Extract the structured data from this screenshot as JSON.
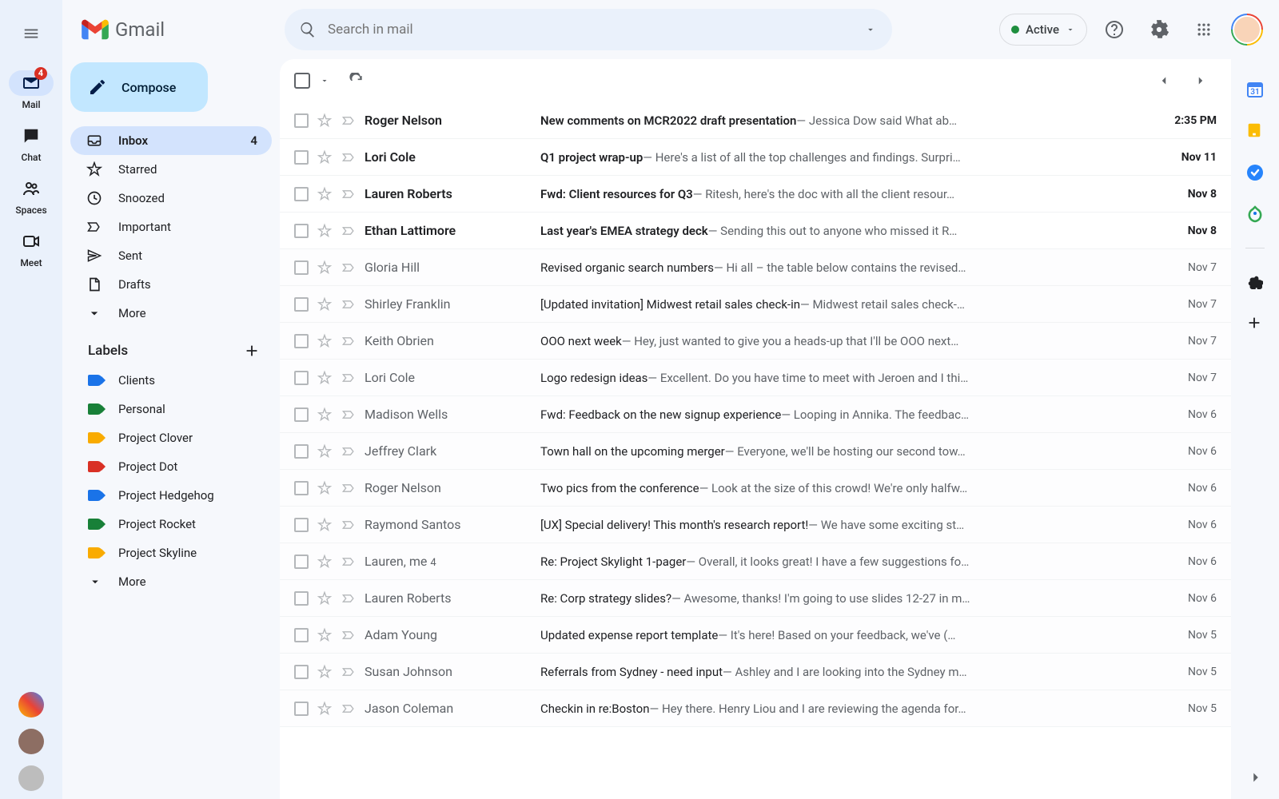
{
  "app": {
    "name": "Gmail"
  },
  "search": {
    "placeholder": "Search in mail"
  },
  "status": {
    "label": "Active"
  },
  "rail": {
    "items": [
      {
        "label": "Mail",
        "badge": "4"
      },
      {
        "label": "Chat"
      },
      {
        "label": "Spaces"
      },
      {
        "label": "Meet"
      }
    ]
  },
  "compose": {
    "label": "Compose"
  },
  "nav": {
    "items": [
      {
        "label": "Inbox",
        "count": "4",
        "icon": "inbox"
      },
      {
        "label": "Starred",
        "icon": "star"
      },
      {
        "label": "Snoozed",
        "icon": "clock"
      },
      {
        "label": "Important",
        "icon": "important"
      },
      {
        "label": "Sent",
        "icon": "send"
      },
      {
        "label": "Drafts",
        "icon": "draft"
      },
      {
        "label": "More",
        "icon": "chevron-down"
      }
    ]
  },
  "labels": {
    "header": "Labels",
    "items": [
      {
        "label": "Clients",
        "color": "#1a73e8"
      },
      {
        "label": "Personal",
        "color": "#188038"
      },
      {
        "label": "Project Clover",
        "color": "#f9ab00"
      },
      {
        "label": "Project Dot",
        "color": "#d93025"
      },
      {
        "label": "Project Hedgehog",
        "color": "#1a73e8"
      },
      {
        "label": "Project Rocket",
        "color": "#188038"
      },
      {
        "label": "Project Skyline",
        "color": "#f9ab00"
      }
    ],
    "more": "More"
  },
  "mail": {
    "rows": [
      {
        "unread": true,
        "sender": "Roger Nelson",
        "subject": "New comments on MCR2022 draft presentation",
        "snippet": "Jessica Dow said What ab…",
        "date": "2:35 PM"
      },
      {
        "unread": true,
        "sender": "Lori Cole",
        "subject": "Q1 project wrap-up",
        "snippet": "Here's a list of all the top challenges and findings. Surpri…",
        "date": "Nov 11"
      },
      {
        "unread": true,
        "sender": "Lauren Roberts",
        "subject": "Fwd: Client resources for Q3",
        "snippet": "Ritesh, here's the doc with all the client resour…",
        "date": "Nov 8"
      },
      {
        "unread": true,
        "sender": "Ethan Lattimore",
        "subject": "Last year's EMEA strategy deck",
        "snippet": "Sending this out to anyone who missed it R…",
        "date": "Nov 8"
      },
      {
        "unread": false,
        "sender": "Gloria Hill",
        "subject": "Revised organic search numbers",
        "snippet": "Hi all – the table below contains the revised…",
        "date": "Nov 7"
      },
      {
        "unread": false,
        "sender": "Shirley Franklin",
        "subject": "[Updated invitation] Midwest retail sales check-in",
        "snippet": "Midwest retail sales check-…",
        "date": "Nov 7"
      },
      {
        "unread": false,
        "sender": "Keith Obrien",
        "subject": "OOO next week",
        "snippet": "Hey, just wanted to give you a heads-up that I'll be OOO next…",
        "date": "Nov 7"
      },
      {
        "unread": false,
        "sender": "Lori Cole",
        "subject": "Logo redesign ideas",
        "snippet": "Excellent. Do you have time to meet with Jeroen and I thi…",
        "date": "Nov 7"
      },
      {
        "unread": false,
        "sender": "Madison Wells",
        "subject": "Fwd: Feedback on the new signup experience",
        "snippet": "Looping in Annika. The feedbac…",
        "date": "Nov 6"
      },
      {
        "unread": false,
        "sender": "Jeffrey Clark",
        "subject": "Town hall on the upcoming merger",
        "snippet": "Everyone, we'll be hosting our second tow…",
        "date": "Nov 6"
      },
      {
        "unread": false,
        "sender": "Roger Nelson",
        "subject": "Two pics from the conference",
        "snippet": "Look at the size of this crowd! We're only halfw…",
        "date": "Nov 6"
      },
      {
        "unread": false,
        "sender": "Raymond Santos",
        "subject": "[UX] Special delivery! This month's research report!",
        "snippet": "We have some exciting st…",
        "date": "Nov 6"
      },
      {
        "unread": false,
        "sender": "Lauren, me",
        "count": "4",
        "subject": "Re: Project Skylight 1-pager",
        "snippet": "Overall, it looks great! I have a few suggestions fo…",
        "date": "Nov 6"
      },
      {
        "unread": false,
        "sender": "Lauren Roberts",
        "subject": "Re: Corp strategy slides?",
        "snippet": "Awesome, thanks! I'm going to use slides 12-27 in m…",
        "date": "Nov 6"
      },
      {
        "unread": false,
        "sender": "Adam Young",
        "subject": "Updated expense report template",
        "snippet": "It's here! Based on your feedback, we've (…",
        "date": "Nov 5"
      },
      {
        "unread": false,
        "sender": "Susan Johnson",
        "subject": "Referrals from Sydney - need input",
        "snippet": "Ashley and I are looking into the Sydney m…",
        "date": "Nov 5"
      },
      {
        "unread": false,
        "sender": "Jason Coleman",
        "subject": "Checkin in re:Boston",
        "snippet": "Hey there. Henry Liou and I are reviewing the agenda for…",
        "date": "Nov 5"
      }
    ]
  },
  "right_rail": {
    "calendar_day": "31"
  }
}
